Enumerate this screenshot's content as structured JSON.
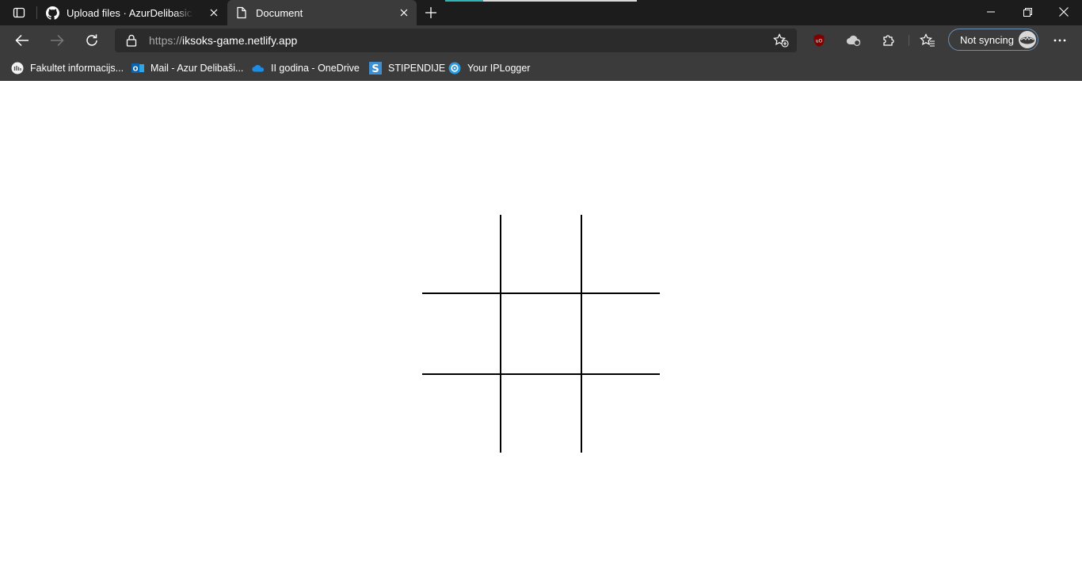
{
  "browser": {
    "tabs": [
      {
        "title": "Upload files · AzurDelibasic/Tic-Tac-Toe",
        "icon": "github-icon"
      },
      {
        "title": "Document",
        "icon": "page-icon",
        "active": true
      }
    ],
    "address": {
      "scheme": "https://",
      "host": "iksoks-game.netlify.app"
    },
    "profile_label": "Not syncing",
    "bookmarks": [
      {
        "label": "Fakultet informacijs...",
        "icon": "fit-icon"
      },
      {
        "label": "Mail - Azur Delibaši...",
        "icon": "outlook-icon"
      },
      {
        "label": "II godina - OneDrive",
        "icon": "onedrive-icon"
      },
      {
        "label": "STIPENDIJE",
        "icon": "s-icon"
      },
      {
        "label": "Your IPLogger",
        "icon": "iplogger-icon"
      }
    ],
    "colors": {
      "tabstrip": "#1c1c1c",
      "toolbar": "#3b3b3b",
      "address": "#2b2b2b",
      "accent": "#2fb3b3"
    }
  },
  "page": {
    "board_cells": [
      "",
      "",
      "",
      "",
      "",
      "",
      "",
      "",
      ""
    ]
  }
}
